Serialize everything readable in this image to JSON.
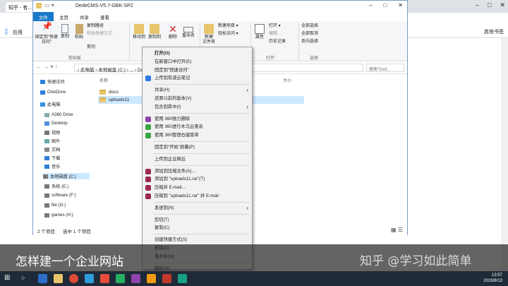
{
  "browser": {
    "tab_label": "知乎 - 有...",
    "bookmark_apps": "应用",
    "right_labels": [
      "其他书签"
    ],
    "right_label2": ""
  },
  "explorer": {
    "title": "DedeCMS-V5.7-GBK-SP2",
    "tabs": [
      "文件",
      "主页",
      "共享",
      "查看"
    ],
    "ribbon": {
      "pin_quick": "固定到\"快速访问\"",
      "copy": "复制",
      "paste": "粘贴",
      "copy_path": "复制路径",
      "paste_shortcut": "粘贴快捷方式",
      "cut": "剪切",
      "move_to": "移动到",
      "copy_to": "复制到",
      "delete": "删除",
      "rename": "重命名",
      "new_folder": "新建\n文件夹",
      "new_item": "新建项目",
      "easy_access": "轻松访问",
      "properties": "属性",
      "open": "打开",
      "edit": "编辑",
      "history": "历史记录",
      "select_all": "全部选择",
      "select_none": "全部取消",
      "invert": "反向选择",
      "group_clipboard": "剪贴板",
      "group_open": "打开",
      "group_select": "选择"
    },
    "address": "›  此电脑  ›  本地磁盘 (C:)  ›  ...  ›  DedeCMS-V5.7-GBK-SP2  ›",
    "search_placeholder": "搜索\"Ded...",
    "nav": {
      "items": [
        {
          "label": "快速访问",
          "icon": "star-icon",
          "color": "#2f7fd6"
        },
        {
          "label": "OneDrive",
          "icon": "cloud-icon",
          "color": "#2f7fd6"
        },
        {
          "label": "此电脑",
          "icon": "computer-icon",
          "color": "#3a8ee6"
        },
        {
          "label": "A360 Drive",
          "icon": "drive-icon",
          "color": "#8aa"
        },
        {
          "label": "Desktop",
          "icon": "desktop-icon",
          "color": "#4a90d9"
        },
        {
          "label": "视频",
          "icon": "video-icon",
          "color": "#777"
        },
        {
          "label": "图片",
          "icon": "picture-icon",
          "color": "#6aa"
        },
        {
          "label": "文档",
          "icon": "document-icon",
          "color": "#888"
        },
        {
          "label": "下载",
          "icon": "download-icon",
          "color": "#2f7fd6"
        },
        {
          "label": "音乐",
          "icon": "music-icon",
          "color": "#2f7fd6"
        },
        {
          "label": "本地磁盘 (C:)",
          "icon": "disk-icon",
          "color": "#777"
        },
        {
          "label": "系统 (E:)",
          "icon": "disk-icon",
          "color": "#777"
        },
        {
          "label": "software (F:)",
          "icon": "disk-icon",
          "color": "#777"
        },
        {
          "label": "file (G:)",
          "icon": "disk-icon",
          "color": "#777"
        },
        {
          "label": "games (H:)",
          "icon": "disk-icon",
          "color": "#777"
        }
      ]
    },
    "columns": {
      "name": "名称",
      "size": "大小"
    },
    "files": [
      {
        "name": "docs",
        "selected": false
      },
      {
        "name": "uploads11",
        "selected": true
      }
    ],
    "status_count": "2 个项目",
    "status_selected": "选中 1 个项目"
  },
  "context_menu": {
    "items": [
      {
        "label": "打开(O)",
        "bold": true
      },
      {
        "label": "在新窗口中打开(E)"
      },
      {
        "label": "固定到\"快速访问\""
      },
      {
        "label": "上传到有道云笔记",
        "icon_color": "#2b7be0"
      },
      {
        "sep": true
      },
      {
        "label": "共享(H)",
        "submenu": true
      },
      {
        "label": "还原以前的版本(V)"
      },
      {
        "label": "包含到库中(I)",
        "submenu": true
      },
      {
        "sep": true
      },
      {
        "label": "使用 360强力删除",
        "icon_color": "#8e44ad"
      },
      {
        "label": "使用 360进行木马云查杀",
        "icon_color": "#3aa745"
      },
      {
        "label": "使用 360管理右键菜单",
        "icon_color": "#3aa745"
      },
      {
        "sep": true
      },
      {
        "label": "固定到\"开始\"屏幕(P)"
      },
      {
        "sep": true
      },
      {
        "label": "上传到企业网云"
      },
      {
        "sep": true
      },
      {
        "label": "添加到压缩文件(A)...",
        "icon_color": "#9c2b4f"
      },
      {
        "label": "添加到 \"uploads11.rar\"(T)",
        "icon_color": "#9c2b4f"
      },
      {
        "label": "压缩并 E-mail...",
        "icon_color": "#9c2b4f"
      },
      {
        "label": "压缩到 \"uploads11.rar\" 并 E-mail",
        "icon_color": "#9c2b4f"
      },
      {
        "sep": true
      },
      {
        "label": "发送到(N)",
        "submenu": true
      },
      {
        "sep": true
      },
      {
        "label": "剪切(T)"
      },
      {
        "label": "复制(C)"
      },
      {
        "sep": true
      },
      {
        "label": "创建快捷方式(S)"
      },
      {
        "label": "删除(D)"
      },
      {
        "label": "重命名(M)"
      },
      {
        "sep": true
      },
      {
        "label": "属性(R)"
      }
    ]
  },
  "caption": "怎样建一个企业网站",
  "watermark": "知乎 @学习如此简单",
  "taskbar": {
    "time": "13:57",
    "date": "2019/8/13"
  }
}
